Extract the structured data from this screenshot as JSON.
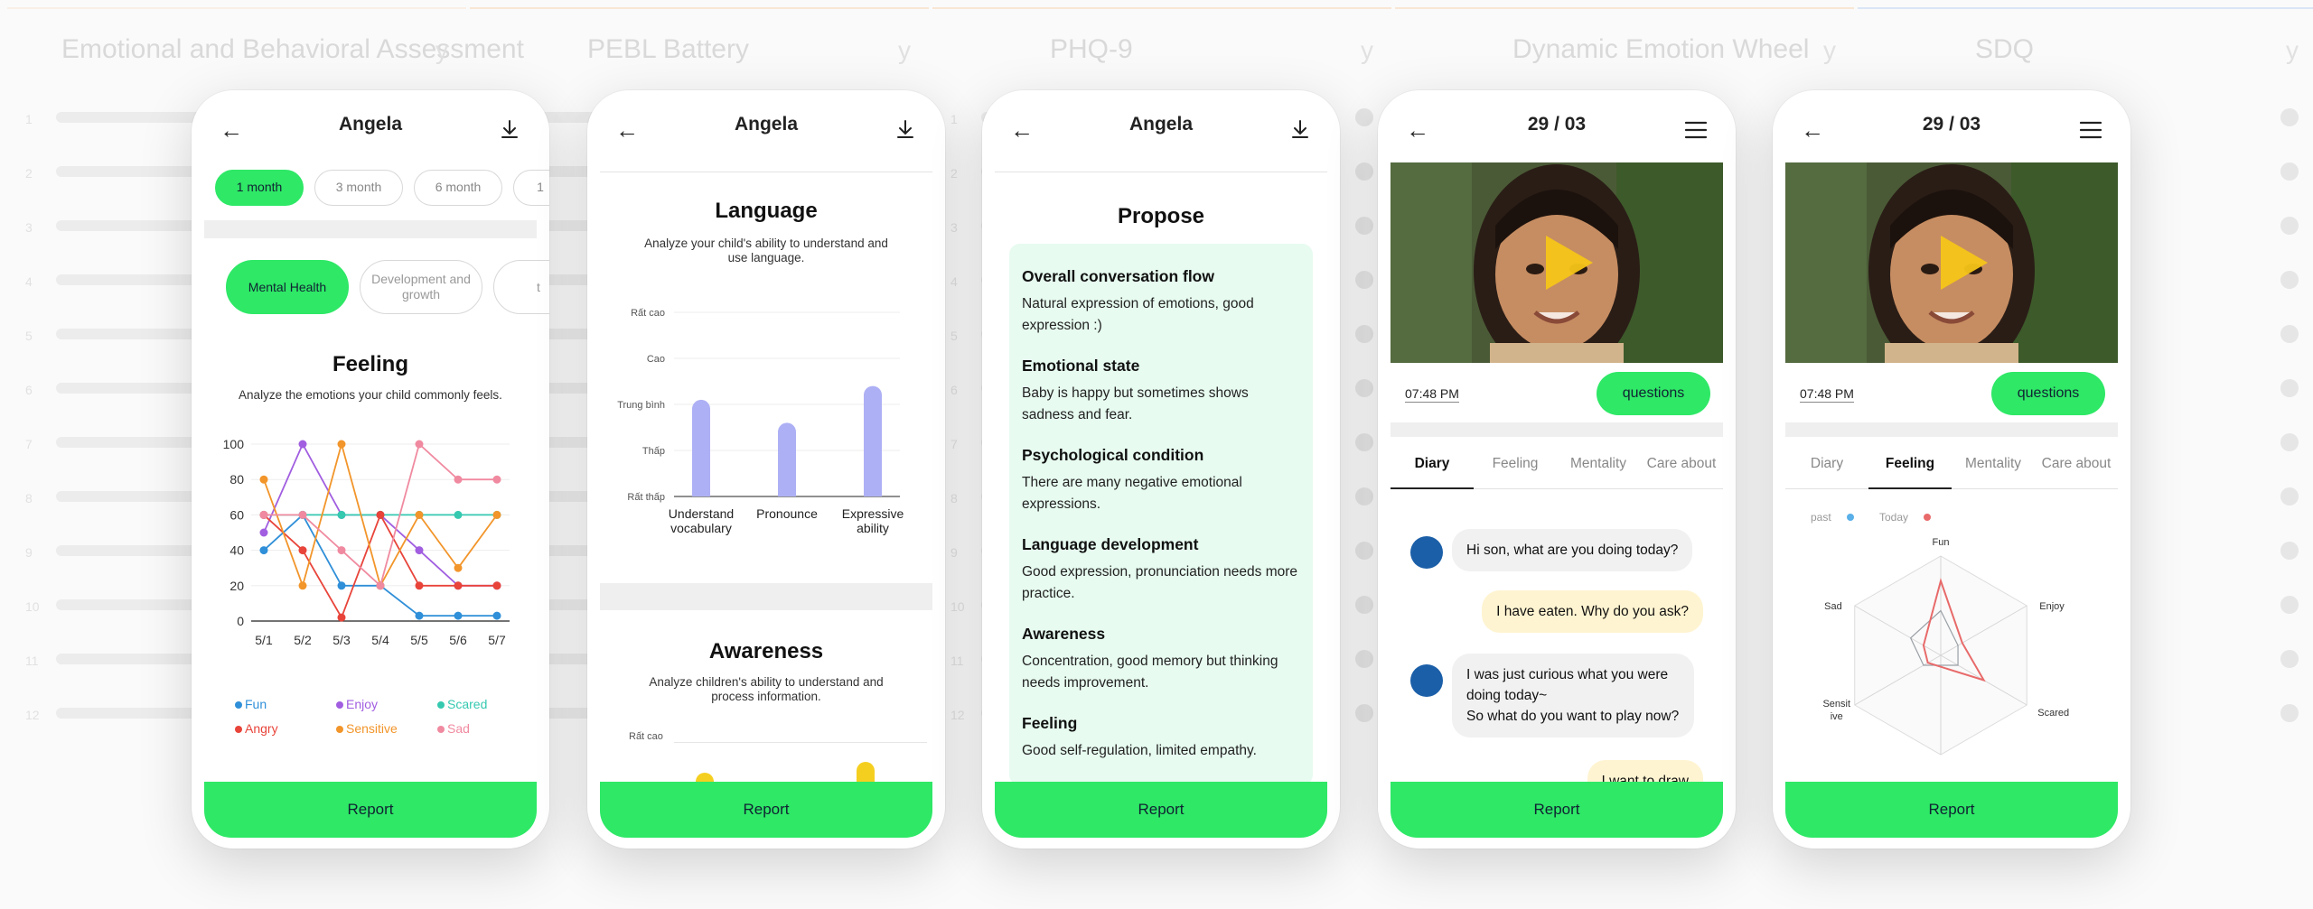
{
  "background": {
    "columns": [
      {
        "title": "Emotional and Behavioral Assessment",
        "axis": "y",
        "line_color": "#f5c6a0"
      },
      {
        "title": "PEBL Battery",
        "axis": "y",
        "line_color": "#f5a050"
      },
      {
        "title": "PHQ-9",
        "axis": "y",
        "line_color": "#f5a050"
      },
      {
        "title": "Dynamic Emotion Wheel",
        "axis": "y",
        "line_color": "#f5a050"
      },
      {
        "title": "SDQ",
        "axis": "y",
        "line_color": "#6a9ae8"
      }
    ]
  },
  "phone1": {
    "title": "Angela",
    "periods": [
      "1 month",
      "3 month",
      "6 month",
      "1"
    ],
    "categories": [
      "Mental Health",
      "Development and growth",
      "t"
    ],
    "section_title": "Feeling",
    "section_subtitle": "Analyze the emotions your child commonly feels.",
    "report_label": "Report",
    "legend": [
      {
        "label": "Fun",
        "color": "#2f8fd8"
      },
      {
        "label": "Enjoy",
        "color": "#a15ee0"
      },
      {
        "label": "Scared",
        "color": "#35c9b0"
      },
      {
        "label": "Angry",
        "color": "#e8443a"
      },
      {
        "label": "Sensitive",
        "color": "#f2952a"
      },
      {
        "label": "Sad",
        "color": "#f08aa0"
      }
    ]
  },
  "phone2": {
    "title": "Angela",
    "section1_title": "Language",
    "section1_subtitle": "Analyze your child's ability to understand and use language.",
    "section2_title": "Awareness",
    "section2_subtitle": "Analyze children's ability to understand and process information.",
    "section2_ytick": "Rất cao",
    "report_label": "Report"
  },
  "phone3": {
    "title": "Angela",
    "heading": "Propose",
    "items": [
      {
        "h": "Overall conversation flow",
        "b": "Natural expression of emotions, good expression :)"
      },
      {
        "h": "Emotional state",
        "b": "Baby is happy but sometimes shows sadness and fear."
      },
      {
        "h": "Psychological condition",
        "b": "There are many negative emotional expressions."
      },
      {
        "h": "Language development",
        "b": "Good expression, pronunciation needs more practice."
      },
      {
        "h": "Awareness",
        "b": "Concentration, good memory but thinking needs improvement."
      },
      {
        "h": "Feeling",
        "b": "Good self-regulation, limited empathy."
      }
    ],
    "report_label": "Report"
  },
  "phone4": {
    "title": "29 / 03",
    "time": "07:48 PM",
    "questions_label": "questions",
    "tabs": [
      "Diary",
      "Feeling",
      "Mentality",
      "Care about"
    ],
    "messages": [
      {
        "from": "in",
        "text": "Hi son, what are you doing today?"
      },
      {
        "from": "out",
        "text": "I have eaten. Why do you ask?"
      },
      {
        "from": "in",
        "text": "I was just curious what you were doing today~\nSo what do you want to play now?"
      },
      {
        "from": "out",
        "text": "I want to draw"
      }
    ],
    "report_label": "Report"
  },
  "phone5": {
    "title": "29 / 03",
    "time": "07:48 PM",
    "questions_label": "questions",
    "tabs": [
      "Diary",
      "Feeling",
      "Mentality",
      "Care about"
    ],
    "legend": [
      {
        "label": "past",
        "color": "#5ab0e8"
      },
      {
        "label": "Today",
        "color": "#e86a6a"
      }
    ],
    "report_label": "Report"
  },
  "chart_data": [
    {
      "type": "line",
      "x": [
        "5/1",
        "5/2",
        "5/3",
        "5/4",
        "5/5",
        "5/6",
        "5/7"
      ],
      "ylim": [
        0,
        100
      ],
      "yticks": [
        0,
        20,
        40,
        60,
        80,
        100
      ],
      "series": [
        {
          "name": "Fun",
          "values": [
            40,
            60,
            20,
            20,
            3,
            3,
            3
          ]
        },
        {
          "name": "Enjoy",
          "values": [
            50,
            100,
            60,
            60,
            40,
            20,
            20
          ]
        },
        {
          "name": "Scared",
          "values": [
            60,
            60,
            60,
            60,
            60,
            60,
            60
          ]
        },
        {
          "name": "Angry",
          "values": [
            60,
            40,
            2,
            60,
            20,
            20,
            20
          ]
        },
        {
          "name": "Sensitive",
          "values": [
            80,
            20,
            100,
            20,
            60,
            30,
            60
          ]
        },
        {
          "name": "Sad",
          "values": [
            60,
            60,
            40,
            20,
            100,
            80,
            80
          ]
        }
      ]
    },
    {
      "type": "bar",
      "categories": [
        "Understand vocabulary",
        "Pronounce",
        "Expressive ability"
      ],
      "yticks": [
        "Rất thấp",
        "Thấp",
        "Trung bình",
        "Cao",
        "Rất cao"
      ],
      "values": [
        3.1,
        2.6,
        3.4
      ],
      "ylim": [
        1,
        5
      ],
      "color": "#aeb0f5"
    },
    {
      "type": "radar",
      "axes": [
        "Fun",
        "Enjoy",
        "Scared",
        "Sensitive",
        "Sad"
      ],
      "series": [
        {
          "name": "past",
          "values": [
            0.45,
            0.2,
            0.2,
            0.2,
            0.35
          ]
        },
        {
          "name": "Today",
          "values": [
            0.75,
            0.25,
            0.5,
            0.15,
            0.2
          ]
        }
      ]
    }
  ]
}
